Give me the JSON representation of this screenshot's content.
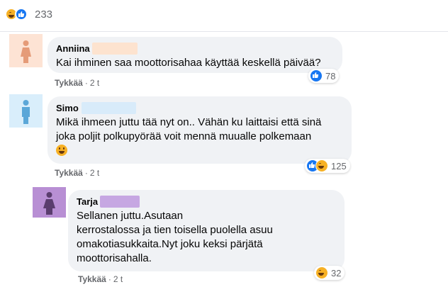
{
  "top_reactions": {
    "count": "233",
    "icons": [
      "haha-icon",
      "like-icon"
    ]
  },
  "colors": {
    "bubble": "#f0f2f5",
    "meta": "#65676b",
    "like": "#1877f2",
    "haha": "#f7b125",
    "avatar_anniina_bg": "#fde3d4",
    "avatar_anniina_fg": "#e59b78",
    "avatar_simo_bg": "#d9eefb",
    "avatar_simo_fg": "#5ba7d8",
    "avatar_tarja_bg": "#b88fd4",
    "avatar_tarja_fg": "#5a3d6e",
    "redact_anniina": "#fde3cf",
    "redact_simo": "#d8ebfa",
    "redact_tarja": "#c6a7e2"
  },
  "comments": [
    {
      "name": "Anniina",
      "text": "Kai ihminen saa moottorisahaa käyttää keskellä päivää?",
      "reactions": {
        "icons": [
          "like-icon"
        ],
        "count": "78"
      },
      "like_label": "Tykkää",
      "time": "2 t",
      "separator": "·"
    },
    {
      "name": "Simo",
      "text_line1": "Mikä ihmeen juttu tää nyt on.. Vähän ku laittaisi että sinä",
      "text_line2": "joka poljit polkupyörää voit mennä muualle polkemaan",
      "emoji": "grinning-face-icon",
      "reactions": {
        "icons": [
          "like-icon",
          "haha-icon"
        ],
        "count": "125"
      },
      "like_label": "Tykkää",
      "time": "2 t",
      "separator": "·"
    },
    {
      "name": "Tarja",
      "text_line1": "Sellanen juttu.Asutaan",
      "text_line2": "kerrostalossa ja tien toisella puolella asuu",
      "text_line3": "omakotiasukkaita.Nyt joku keksi pärjätä",
      "text_line4": "moottorisahalla.",
      "reactions": {
        "icons": [
          "haha-icon"
        ],
        "count": "32"
      },
      "like_label": "Tykkää",
      "time": "2 t",
      "separator": "·"
    }
  ]
}
